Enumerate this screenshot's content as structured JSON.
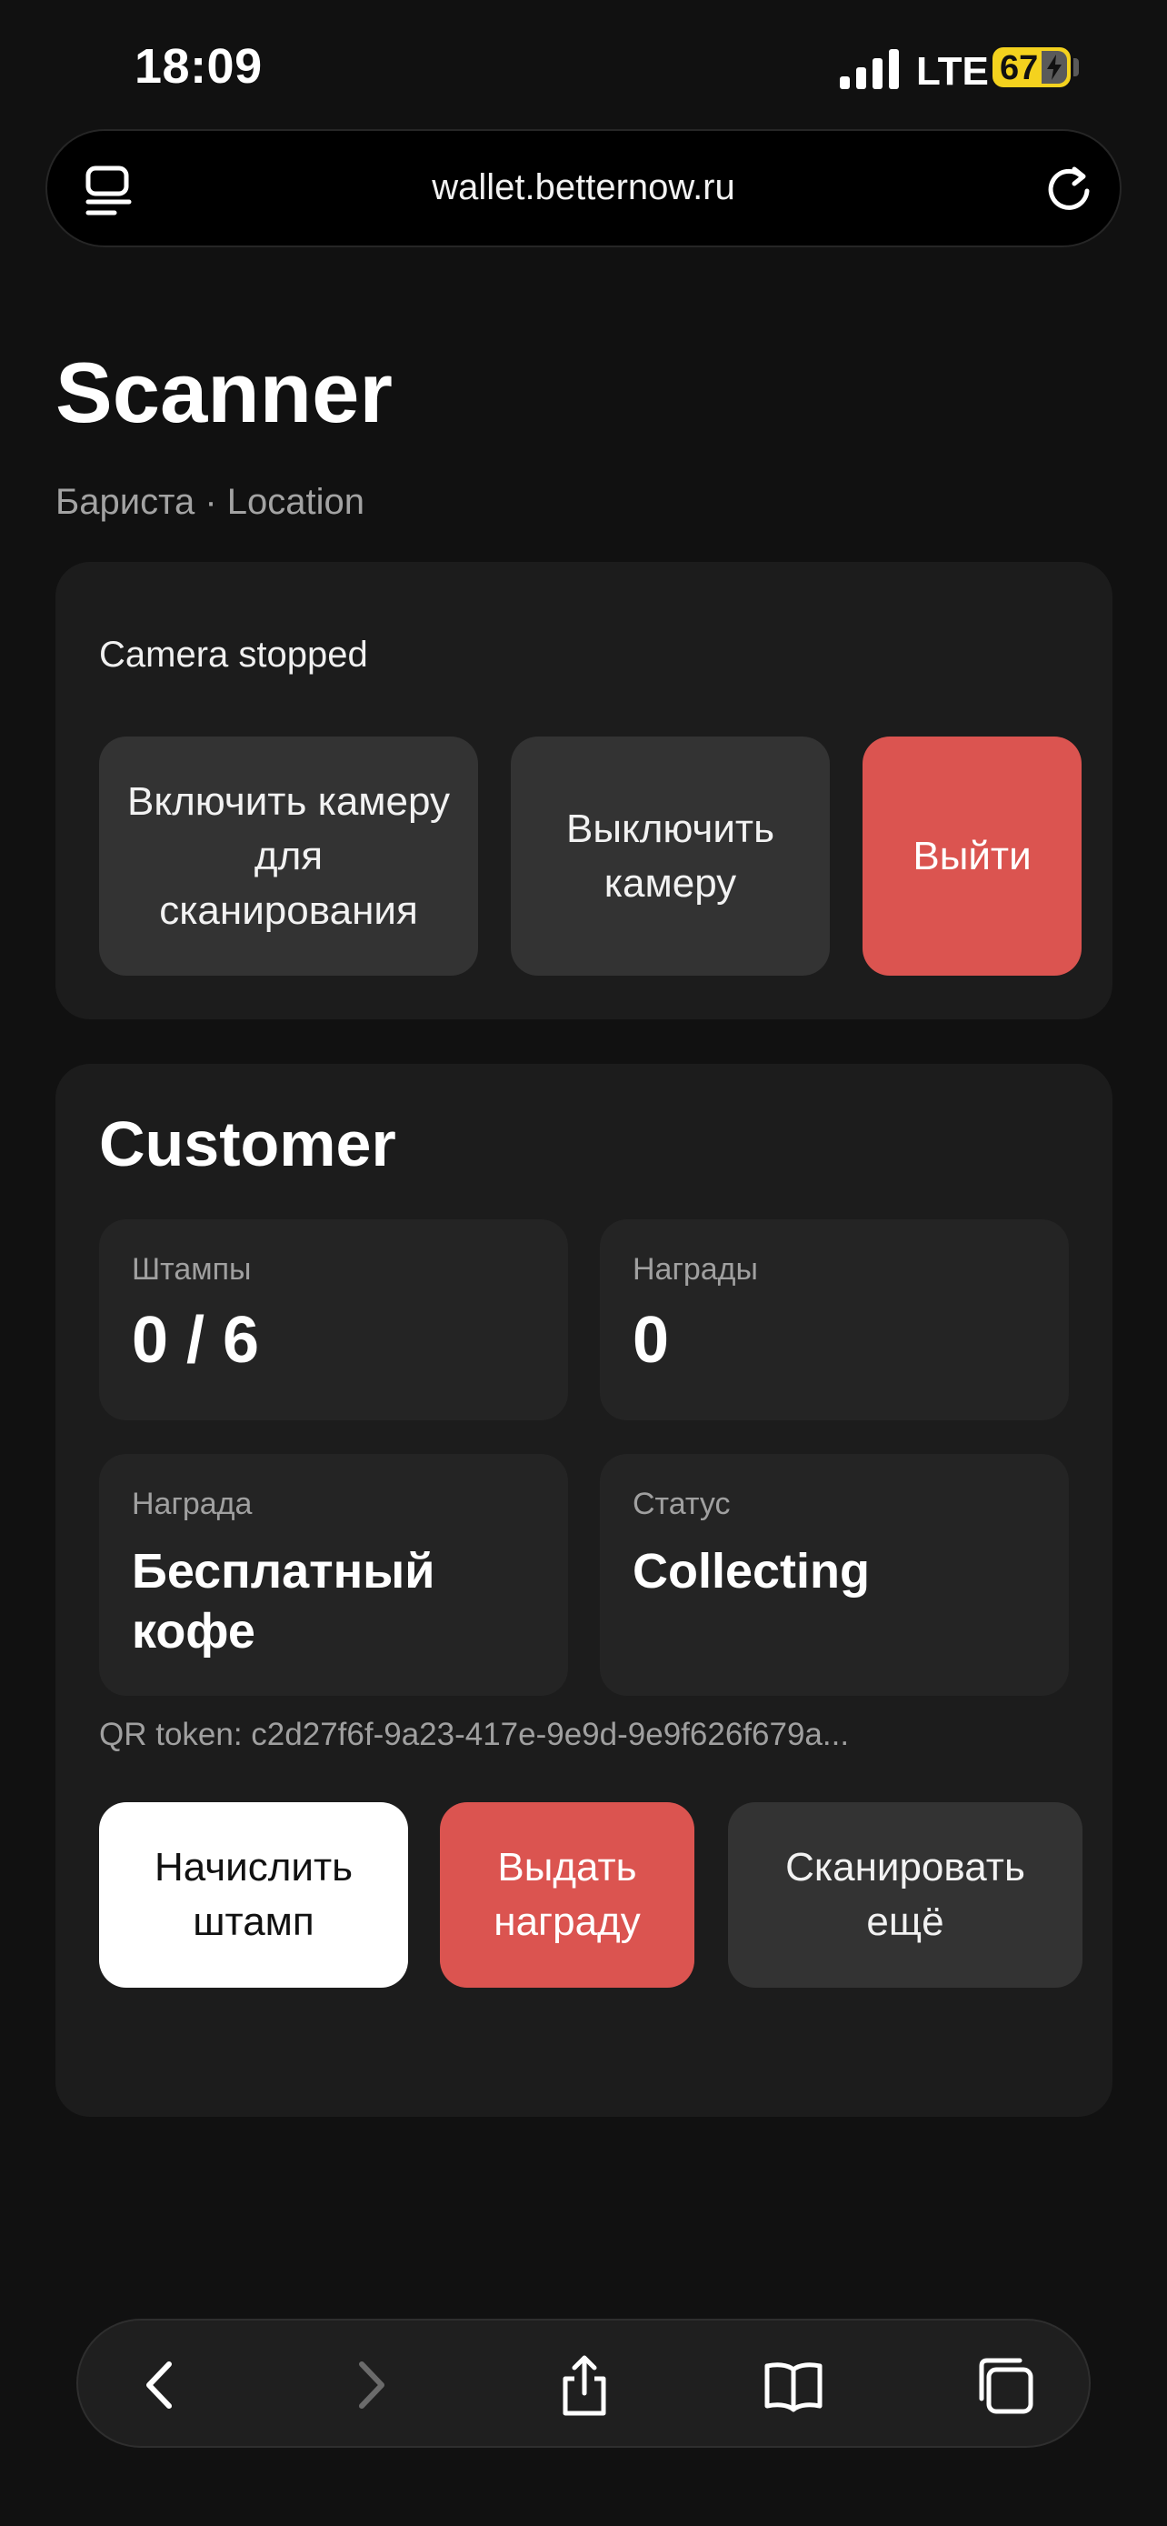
{
  "status_bar": {
    "time": "18:09",
    "network": "LTE",
    "battery": "67"
  },
  "browser": {
    "url": "wallet.betternow.ru"
  },
  "header": {
    "title": "Scanner",
    "subtitle": "Бариста · Location"
  },
  "camera": {
    "status": "Camera stopped",
    "start_label": "Включить камеру для сканирования",
    "stop_label": "Выключить камеру",
    "logout_label": "Выйти"
  },
  "customer": {
    "title": "Customer",
    "stamps_label": "Штампы",
    "stamps_value": "0 / 6",
    "rewards_label": "Награды",
    "rewards_value": "0",
    "reward_label": "Награда",
    "reward_value": "Бесплатный кофе",
    "status_label": "Статус",
    "status_value": "Collecting",
    "qr_token": "QR token: c2d27f6f-9a23-417e-9e9d-9e9f626f679a...",
    "add_stamp_label": "Начислить штамп",
    "redeem_label": "Выдать награду",
    "scan_again_label": "Сканировать ещё"
  },
  "colors": {
    "accent_red": "#db5450",
    "background": "#111111",
    "card": "#1c1c1c",
    "battery": "#f4d21e"
  },
  "icons": [
    "tabs-icon",
    "reload-icon",
    "back-icon",
    "forward-icon",
    "share-icon",
    "bookmarks-icon",
    "tabs-overview-icon"
  ]
}
